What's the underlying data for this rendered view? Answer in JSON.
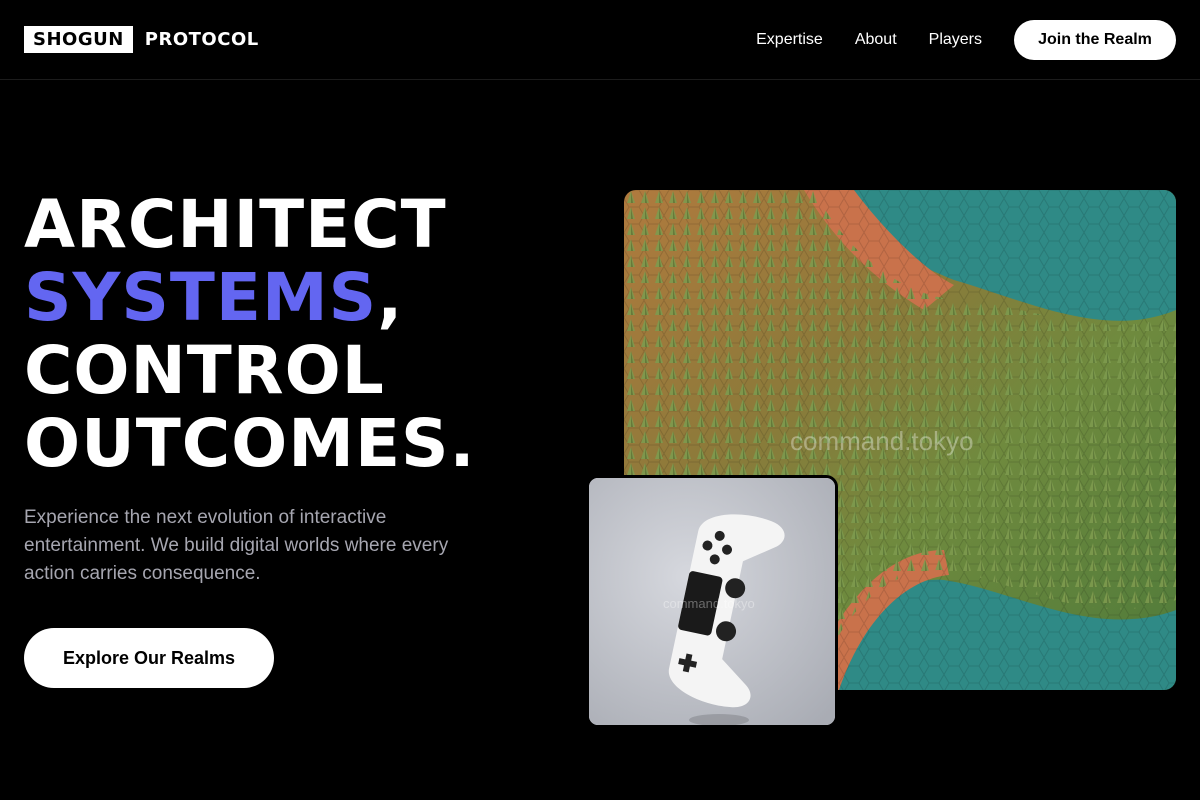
{
  "brand": {
    "box_text": "SHOGUN",
    "text": "PROTOCOL"
  },
  "nav": {
    "links": [
      "Expertise",
      "About",
      "Players"
    ],
    "cta_label": "Join the Realm"
  },
  "hero": {
    "headline_line1": "ARCHITECT",
    "headline_accent": "SYSTEMS",
    "headline_comma": ",",
    "headline_line3": "CONTROL",
    "headline_line4": "OUTCOMES.",
    "description": "Experience the next evolution of interactive entertainment. We build digital worlds where every action carries consequence.",
    "button_label": "Explore Our Realms"
  },
  "images": {
    "main_watermark": "command.tokyo",
    "inset_watermark": "command.tokyo"
  },
  "colors": {
    "accent": "#6366f1",
    "background": "#000000"
  }
}
